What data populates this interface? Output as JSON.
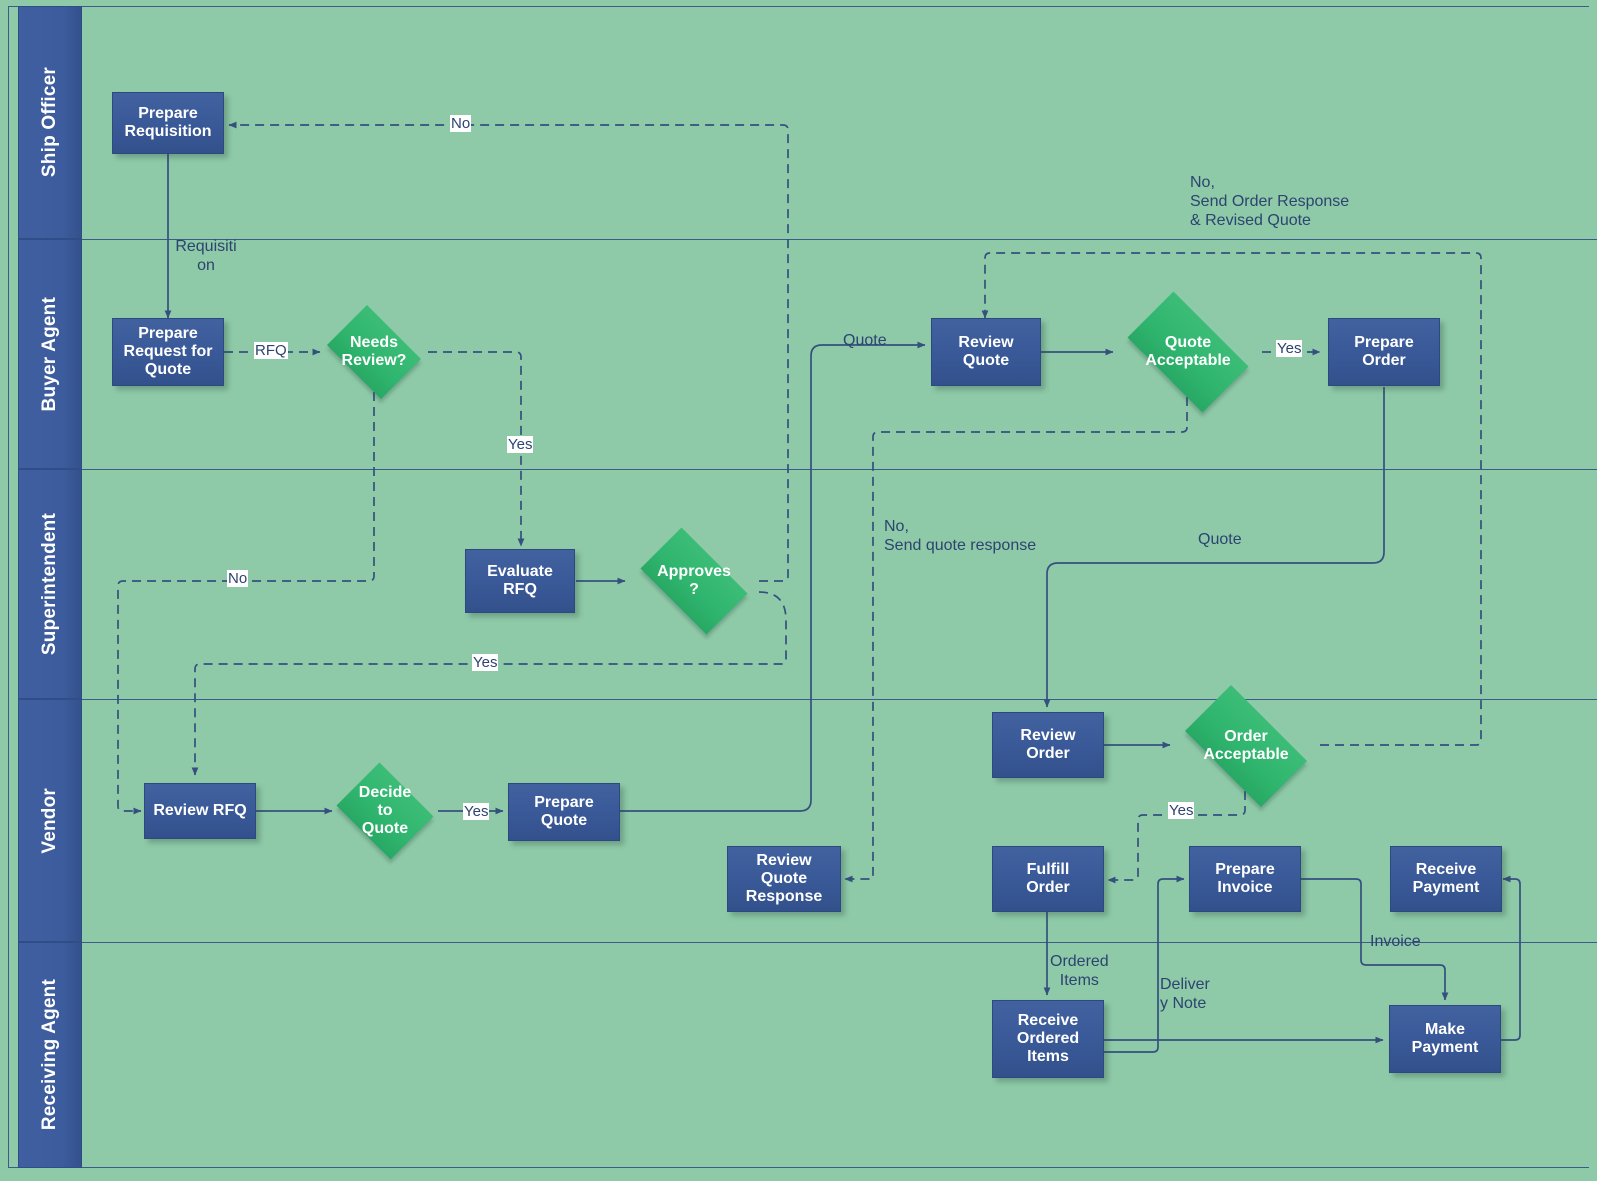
{
  "diagram": {
    "title": "Procurement Swimlane Flowchart",
    "type": "swimlane-flowchart",
    "colors": {
      "background": "#8ecaa8",
      "lane_header": "#3a5998",
      "process_fill": "#3a5998",
      "decision_fill": "#2fb56e",
      "connector": "#35507f",
      "text_light": "#ffffff",
      "text_dark": "#2d4370"
    },
    "lanes": [
      {
        "id": "ship_officer",
        "label": "Ship Officer"
      },
      {
        "id": "buyer_agent",
        "label": "Buyer Agent"
      },
      {
        "id": "superintendent",
        "label": "Superintendent"
      },
      {
        "id": "vendor",
        "label": "Vendor"
      },
      {
        "id": "receiving_agent",
        "label": "Receiving Agent"
      }
    ],
    "nodes": [
      {
        "id": "prepare_requisition",
        "lane": "ship_officer",
        "shape": "process",
        "label": "Prepare\nRequisition"
      },
      {
        "id": "prepare_rfq",
        "lane": "buyer_agent",
        "shape": "process",
        "label": "Prepare\nRequest for\nQuote"
      },
      {
        "id": "needs_review",
        "lane": "buyer_agent",
        "shape": "decision",
        "label": "Needs\nReview?"
      },
      {
        "id": "review_quote",
        "lane": "buyer_agent",
        "shape": "process",
        "label": "Review\nQuote"
      },
      {
        "id": "quote_acceptable",
        "lane": "buyer_agent",
        "shape": "decision",
        "label": "Quote\nAcceptable"
      },
      {
        "id": "prepare_order",
        "lane": "buyer_agent",
        "shape": "process",
        "label": "Prepare\nOrder"
      },
      {
        "id": "evaluate_rfq",
        "lane": "superintendent",
        "shape": "process",
        "label": "Evaluate\nRFQ"
      },
      {
        "id": "approves",
        "lane": "superintendent",
        "shape": "decision",
        "label": "Approves\n?"
      },
      {
        "id": "review_rfq",
        "lane": "vendor",
        "shape": "process",
        "label": "Review RFQ"
      },
      {
        "id": "decide_to_quote",
        "lane": "vendor",
        "shape": "decision",
        "label": "Decide\nto\nQuote"
      },
      {
        "id": "prepare_quote",
        "lane": "vendor",
        "shape": "process",
        "label": "Prepare\nQuote"
      },
      {
        "id": "review_quote_resp",
        "lane": "vendor",
        "shape": "process",
        "label": "Review\nQuote\nResponse"
      },
      {
        "id": "review_order",
        "lane": "vendor",
        "shape": "process",
        "label": "Review\nOrder"
      },
      {
        "id": "order_acceptable",
        "lane": "vendor",
        "shape": "decision",
        "label": "Order\nAcceptable"
      },
      {
        "id": "fulfill_order",
        "lane": "vendor",
        "shape": "process",
        "label": "Fulfill\nOrder"
      },
      {
        "id": "prepare_invoice",
        "lane": "vendor",
        "shape": "process",
        "label": "Prepare\nInvoice"
      },
      {
        "id": "receive_payment",
        "lane": "vendor",
        "shape": "process",
        "label": "Receive\nPayment"
      },
      {
        "id": "receive_ordered",
        "lane": "receiving_agent",
        "shape": "process",
        "label": "Receive\nOrdered\nItems"
      },
      {
        "id": "make_payment",
        "lane": "receiving_agent",
        "shape": "process",
        "label": "Make\nPayment"
      }
    ],
    "edge_labels": [
      {
        "id": "lbl_no_top",
        "text": "No"
      },
      {
        "id": "lbl_requisition",
        "text": "Requisiti\non"
      },
      {
        "id": "lbl_rfq",
        "text": "RFQ"
      },
      {
        "id": "lbl_yes_needs",
        "text": "Yes"
      },
      {
        "id": "lbl_no_needs",
        "text": "No"
      },
      {
        "id": "lbl_yes_approves",
        "text": "Yes"
      },
      {
        "id": "lbl_yes_decide",
        "text": "Yes"
      },
      {
        "id": "lbl_quote_in",
        "text": "Quote"
      },
      {
        "id": "lbl_yes_quote_acc",
        "text": "Yes"
      },
      {
        "id": "lbl_yes_order_acc",
        "text": "Yes"
      },
      {
        "id": "lbl_no_order",
        "text": "No,\nSend Order Response\n& Revised Quote"
      },
      {
        "id": "lbl_no_quote_resp",
        "text": "No,\nSend quote response"
      },
      {
        "id": "lbl_quote_order",
        "text": "Quote"
      },
      {
        "id": "lbl_ordered_items",
        "text": "Ordered\nItems"
      },
      {
        "id": "lbl_delivery_note",
        "text": "Deliver\ny Note"
      },
      {
        "id": "lbl_invoice",
        "text": "Invoice"
      }
    ]
  }
}
